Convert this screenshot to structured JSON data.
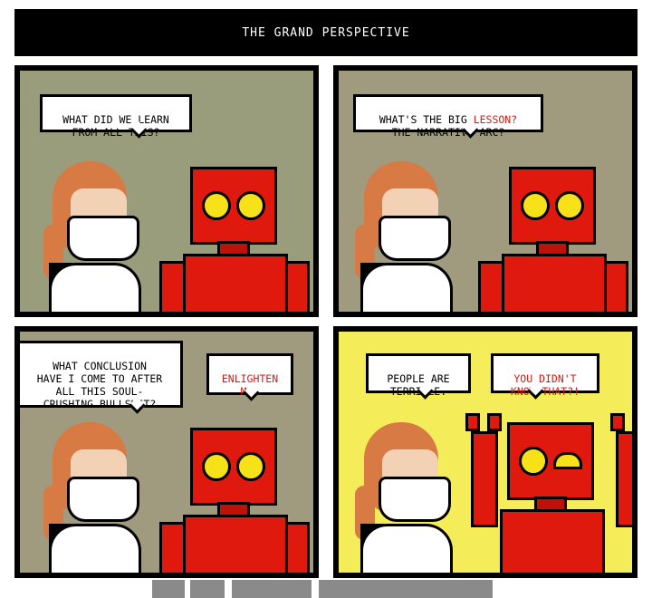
{
  "title": "THE GRAND PERSPECTIVE",
  "panels": [
    {
      "bubbles": [
        {
          "text": "WHAT DID WE LEARN\nFROM ALL THIS?"
        }
      ]
    },
    {
      "bubbles": [
        {
          "pre": "WHAT'S THE BIG ",
          "hl": "LESSON?",
          "post": "\nTHE NARRATIVE ARC?"
        }
      ]
    },
    {
      "bubbles": [
        {
          "text": "WHAT CONCLUSION\nHAVE I COME TO AFTER\nALL THIS SOUL-\nCRUSHING BULLSHIT?"
        },
        {
          "text": "ENLIGHTEN\nME."
        }
      ]
    },
    {
      "bubbles": [
        {
          "text": "PEOPLE ARE\nTERRIBLE."
        },
        {
          "text": "YOU DIDN'T\nKNOW THAT?!"
        }
      ]
    }
  ],
  "colors": {
    "highlight": "#d21b14",
    "robot": "#e0190f",
    "panel4_bg": "#f5ec5a"
  }
}
